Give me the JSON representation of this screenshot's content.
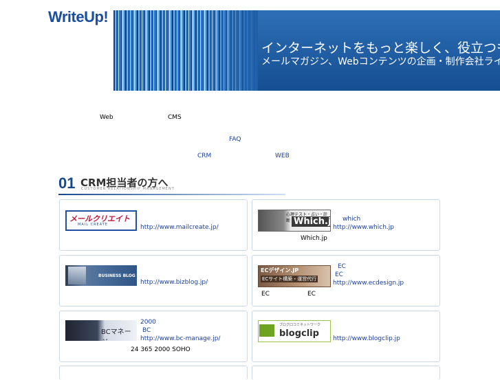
{
  "header": {
    "logo": "WriteUp!",
    "banner_line1": "インターネットをもっと楽しく、役立つものに",
    "banner_line2": "メールマガジン、Webコンテンツの企画・制作会社ライト"
  },
  "intro": {
    "t1": "Web",
    "t2": "CMS",
    "t3": "FAQ",
    "t4": "CRM",
    "t5": "WEB"
  },
  "section": {
    "num": "01",
    "title": "CRM担当者の方へ",
    "subtitle": "CUSTOMER RELATIONSHIP MANAGEMENT"
  },
  "cards": {
    "mailcreate": {
      "banner": "メールクリエイト",
      "banner_sub": "MAIL CREATE",
      "url": "http://www.mailcreate.jp/"
    },
    "which": {
      "banner_top": "心理テスト・占い・診断",
      "banner_main": "Which.jp",
      "name": "which",
      "url": "http://www.which.jp",
      "desc": "Which.jp"
    },
    "bizblog": {
      "banner": "BUSINESS BLOG",
      "url": "http://www.bizblog.jp/"
    },
    "ecdesign": {
      "banner_top": "ECデザイン.JP",
      "banner_sub": "ECサイト構築・運営代行",
      "l1": "EC",
      "l2": "EC",
      "url": "http://www.ecdesign.jp",
      "d1": "EC",
      "d2": "EC"
    },
    "bcmanage": {
      "banner": "BCマネージ",
      "l1": "2000",
      "l2": "BC",
      "url": "http://www.bc-manage.jp/",
      "desc": "24  365  2000  SOHO"
    },
    "blogclip": {
      "banner_top": "ブログ口コミネットワーク",
      "banner_main": "blogclip",
      "url": "http://www.blogclip.jp"
    }
  },
  "colors": {
    "brand": "#1a4ea0",
    "link": "#1a3f9e",
    "card_border": "#c9d9ea"
  }
}
